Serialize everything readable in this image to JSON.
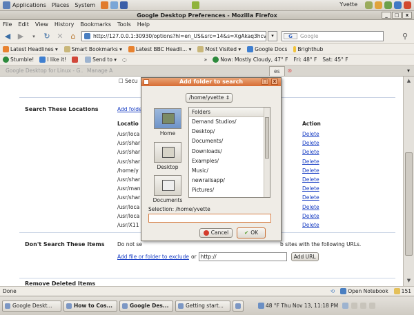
{
  "top_panel": {
    "menus": [
      "Applications",
      "Places",
      "System"
    ],
    "user": "Yvette"
  },
  "window": {
    "title": "Google Desktop Preferences - Mozilla Firefox",
    "controls": [
      "_",
      "□",
      "x"
    ]
  },
  "menubar": [
    "File",
    "Edit",
    "View",
    "History",
    "Bookmarks",
    "Tools",
    "Help"
  ],
  "navbar": {
    "url": "http://127.0.0.1:30930/options?hl=en_US&src=14&s=XgAkaq3hcvU",
    "search_engine": "G",
    "search_placeholder": "Google"
  },
  "bookmarks": [
    "Latest Headlines",
    "Smart Bookmarks",
    "Latest BBC Headli...",
    "Most Visited",
    "Google Docs",
    "Brighthub"
  ],
  "stumblebar": {
    "items": [
      "Stumble!",
      "I like it!",
      "Send to"
    ],
    "weather_now": "Now: Mostly Cloudy, 47° F",
    "weather_fri": "Fri: 48° F",
    "weather_sat": "Sat: 45° F"
  },
  "tabs": [
    {
      "label": "Google Desktop for Linux - G...",
      "active": false
    },
    {
      "label": "Manage A",
      "active": false
    },
    {
      "label": "es",
      "active": true
    }
  ],
  "page": {
    "secu_text": "Secu",
    "search_locations": {
      "title": "Search These Locations",
      "add_link": "Add folde",
      "col_location": "Locatio",
      "col_action": "Action",
      "paths": [
        "/usr/loca",
        "/usr/shar",
        "/usr/shar",
        "/usr/shar",
        "/home/y",
        "/usr/shar",
        "/usr/man",
        "/usr/shar",
        "/usr/loca",
        "/usr/loca",
        "/usr/X11"
      ],
      "action_label": "Delete"
    },
    "dont_search": {
      "title": "Don't Search These Items",
      "desc_left": "Do not se",
      "desc_right": "b sites with the following URLs.",
      "add_link": "Add file or folder to exclude",
      "or_text": "or",
      "url_value": "http://",
      "add_url_button": "Add URL"
    },
    "removed_title": "Remove Deleted Items"
  },
  "dialog": {
    "title": "Add folder to search",
    "path": "/home/yvette",
    "places": [
      "Home",
      "Desktop",
      "Documents"
    ],
    "folders_header": "Folders",
    "folders": [
      "Demand Studios/",
      "Desktop/",
      "Documents/",
      "Downloads/",
      "Examples/",
      "Music/",
      "newrailsapp/",
      "Pictures/"
    ],
    "selection_label": "Selection: /home/yvette",
    "selection_value": "",
    "cancel_label": "Cancel",
    "ok_label": "OK"
  },
  "statusbar": {
    "status": "Done",
    "open_notebook": "Open Notebook",
    "count": "151"
  },
  "taskbar": {
    "tasks": [
      "Google Deskt...",
      "How to Cos...",
      "Google Des...",
      "Getting start..."
    ],
    "clock": "48 °F Thu Nov 13, 11:18 PM"
  }
}
